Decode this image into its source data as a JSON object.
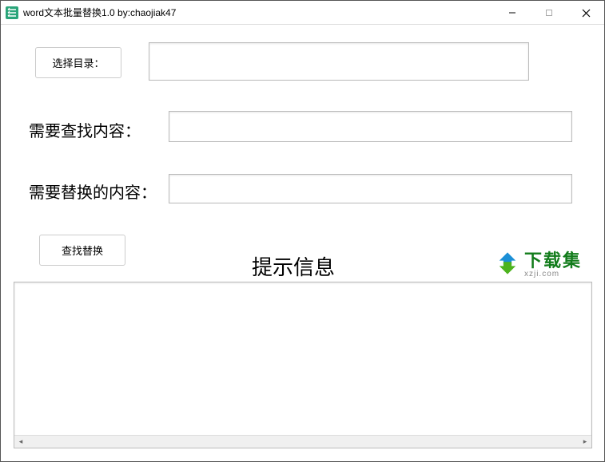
{
  "window": {
    "title": "word文本批量替换1.0    by:chaojiak47"
  },
  "buttons": {
    "select_dir": "选择目录：",
    "find_replace": "查找替换"
  },
  "labels": {
    "find_content": "需要查找内容：",
    "replace_content": "需要替换的内容：",
    "info_header": "提示信息"
  },
  "inputs": {
    "dir_value": "",
    "find_value": "",
    "replace_value": "",
    "output_value": ""
  },
  "watermark": {
    "cn": "下载集",
    "en": "xzji.com"
  }
}
